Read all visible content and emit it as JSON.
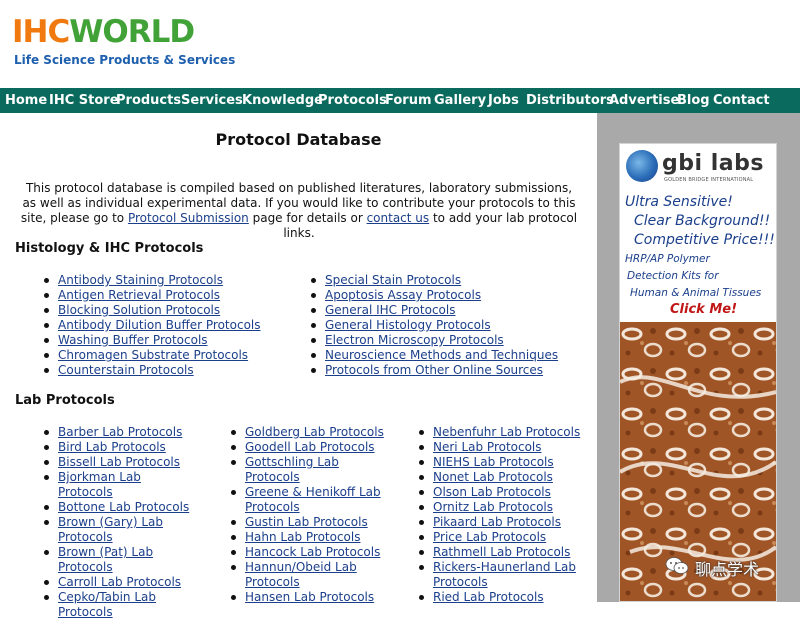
{
  "header": {
    "logo_part1": "IHC",
    "logo_part2": "WORLD",
    "tagline": "Life Science Products & Services"
  },
  "nav": [
    "Home",
    "IHC Store",
    "Products",
    "Services",
    "Knowledge",
    "Protocols",
    "Forum",
    "Gallery",
    "Jobs",
    "Distributors",
    "Advertise",
    "Blog",
    "Contact"
  ],
  "page": {
    "title": "Protocol Database",
    "intro_text1": "This protocol database is compiled based on published literatures, laboratory submissions, as well as individual experimental data. If you would like to contribute your protocols to this site, please go to ",
    "intro_link1": "Protocol Submission",
    "intro_text2": " page for details or ",
    "intro_link2": "contact us",
    "intro_text3": " to add your lab protocol links."
  },
  "histology": {
    "heading": "Histology & IHC Protocols",
    "col1": [
      "Antibody Staining Protocols",
      "Antigen Retrieval Protocols",
      "Blocking Solution Protocols",
      "Antibody Dilution Buffer Protocols",
      "Washing Buffer Protocols",
      "Chromagen Substrate Protocols",
      "Counterstain Protocols"
    ],
    "col2": [
      "Special Stain Protocols",
      "Apoptosis Assay Protocols",
      "General IHC Protocols",
      "General Histology Protocols",
      "Electron Microscopy Protocols",
      "Neuroscience Methods and Techniques",
      "Protocols from Other Online Sources"
    ]
  },
  "lab": {
    "heading": "Lab Protocols",
    "col1": [
      "Barber Lab Protocols",
      "Bird Lab Protocols",
      "Bissell Lab Protocols",
      "Bjorkman Lab Protocols",
      "Bottone Lab Protocols",
      "Brown (Gary) Lab Protocols",
      "Brown (Pat) Lab Protocols",
      "Carroll Lab Protocols",
      "Cepko/Tabin Lab Protocols"
    ],
    "col2": [
      "Goldberg Lab Protocols",
      "Goodell Lab Protocols",
      "Gottschling Lab Protocols",
      "Greene & Henikoff Lab Protocols",
      "Gustin Lab Protocols",
      "Hahn Lab Protocols",
      "Hancock Lab Protocols",
      "Hannun/Obeid Lab Protocols",
      "Hansen Lab Protocols"
    ],
    "col3": [
      "Nebenfuhr Lab Protocols",
      "Neri Lab Protocols",
      "NIEHS Lab Protocols",
      "Nonet Lab Protocols",
      "Olson Lab Protocols",
      "Ornitz Lab Protocols",
      "Pikaard Lab Protocols",
      "Price Lab Protocols",
      "Rathmell Lab Protocols",
      "Rickers-Haunerland Lab Protocols",
      "Ried Lab Protocols"
    ]
  },
  "ad": {
    "brand": "gbi labs",
    "brand_sub": "GOLDEN BRIDGE INTERNATIONAL",
    "line1": "Ultra Sensitive!",
    "line2": "Clear Background!!",
    "line3": "Competitive Price!!!",
    "line4": "HRP/AP Polymer",
    "line5": "Detection Kits for",
    "line6": "Human & Animal Tissues",
    "cta": "Click Me!"
  },
  "watermark": {
    "text": "聊点学术"
  },
  "colors": {
    "nav_bg": "#0a6a5d",
    "link": "#1b3f8b",
    "sidebar_bg": "#a9a9a9",
    "logo_orange": "#f07a10",
    "logo_green": "#41a337"
  }
}
